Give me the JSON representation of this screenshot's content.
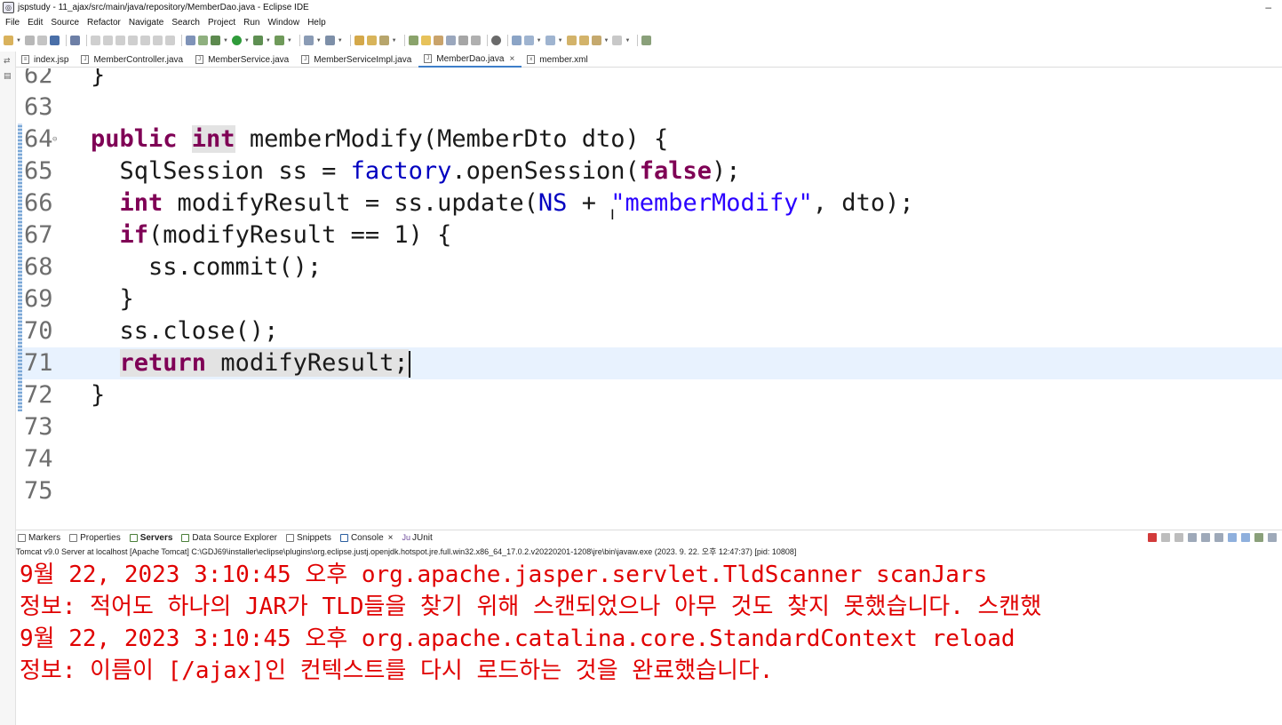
{
  "window": {
    "title": "jspstudy - 11_ajax/src/main/java/repository/MemberDao.java - Eclipse IDE",
    "minimize": "–"
  },
  "menu": [
    "File",
    "Edit",
    "Source",
    "Refactor",
    "Navigate",
    "Search",
    "Project",
    "Run",
    "Window",
    "Help"
  ],
  "tabs": [
    {
      "label": "index.jsp",
      "icon": "jsp-file-icon"
    },
    {
      "label": "MemberController.java",
      "icon": "java-file-icon"
    },
    {
      "label": "MemberService.java",
      "icon": "java-file-icon"
    },
    {
      "label": "MemberServiceImpl.java",
      "icon": "java-file-icon"
    },
    {
      "label": "MemberDao.java",
      "icon": "java-file-icon",
      "active": true,
      "close": "×"
    },
    {
      "label": "member.xml",
      "icon": "xml-file-icon"
    }
  ],
  "editor": {
    "lines": [
      {
        "n": "62",
        "t": "}"
      },
      {
        "n": "63",
        "t": ""
      },
      {
        "n": "64",
        "fold": "⊖"
      },
      {
        "n": "65"
      },
      {
        "n": "66"
      },
      {
        "n": "67"
      },
      {
        "n": "68"
      },
      {
        "n": "69",
        "t": "  }"
      },
      {
        "n": "70",
        "t": "  ss.close();"
      },
      {
        "n": "71"
      },
      {
        "n": "72",
        "t": "}"
      },
      {
        "n": "73",
        "t": ""
      },
      {
        "n": "74",
        "t": ""
      },
      {
        "n": "75",
        "t": ""
      }
    ],
    "tokens": {
      "public": "public ",
      "int": "int",
      "sig_rest": " memberModify(MemberDto dto) {",
      "l65_a": "  SqlSession ss = ",
      "factory": "factory",
      "l65_b": ".openSession(",
      "false": "false",
      "l65_c": ");",
      "l66_int": "  int",
      "l66_a": " modifyResult = ss.update(",
      "NS": "NS",
      "l66_b": " + ",
      "str": "\"memberModify\"",
      "l66_c": ", dto);",
      "if": "  if",
      "l67_rest": "(modifyResult == 1) {",
      "l68": "    ss.commit();",
      "return": "return",
      "l71_rest": " modifyResult;"
    },
    "hscroll": "<"
  },
  "console": {
    "tabs": [
      {
        "label": "Markers",
        "icon": "markers-icon"
      },
      {
        "label": "Properties",
        "icon": "properties-icon"
      },
      {
        "label": "Servers",
        "icon": "servers-icon",
        "bold": true
      },
      {
        "label": "Data Source Explorer",
        "icon": "data-source-icon"
      },
      {
        "label": "Snippets",
        "icon": "snippets-icon"
      },
      {
        "label": "Console",
        "icon": "console-icon",
        "active": true,
        "close": "×"
      },
      {
        "label": "JUnit",
        "icon": "junit-icon"
      }
    ],
    "description": "Tomcat v9.0 Server at localhost [Apache Tomcat] C:\\GDJ69\\installer\\eclipse\\plugins\\org.eclipse.justj.openjdk.hotspot.jre.full.win32.x86_64_17.0.2.v20220201-1208\\jre\\bin\\javaw.exe  (2023. 9. 22. 오후 12:47:37) [pid: 10808]",
    "output": [
      "9월 22, 2023 3:10:45 오후 org.apache.jasper.servlet.TldScanner scanJars",
      "정보: 적어도 하나의 JAR가 TLD들을 찾기 위해 스캔되었으나 아무 것도 찾지 못했습니다. 스캔했",
      "9월 22, 2023 3:10:45 오후 org.apache.catalina.core.StandardContext reload",
      "정보: 이름이 [/ajax]인 컨텍스트를 다시 로드하는 것을 완료했습니다."
    ]
  },
  "colors": {
    "keyword": "#7f0055",
    "field": "#0000c0",
    "string": "#2a00ff",
    "console_text": "#e00000",
    "current_line": "#e8f2fe",
    "active_tab_accent": "#3d7ec9"
  }
}
